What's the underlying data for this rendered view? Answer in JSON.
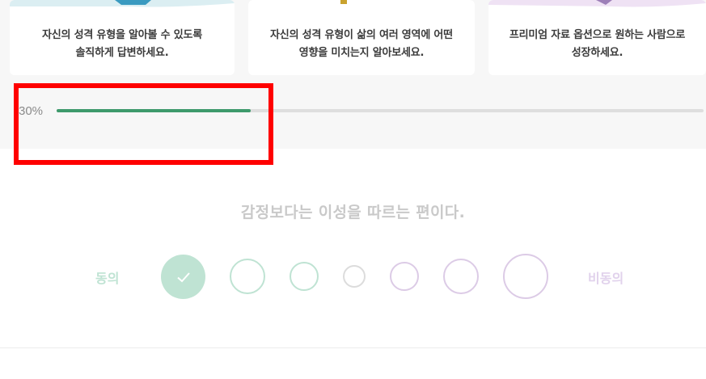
{
  "cards": [
    {
      "text": "자신의 성격 유형을 알아볼 수 있도록\n솔직하게 답변하세요."
    },
    {
      "text": "자신의 성격 유형이 삶의 여러 영역에 어떤\n영향을 미치는지 알아보세요."
    },
    {
      "text": "프리미엄 자료 옵션으로 원하는 사람으로\n성장하세요."
    }
  ],
  "progress": {
    "percent_label": "30%",
    "value": 0.3,
    "color": "#3e9a6c"
  },
  "question": {
    "text": "감정보다는 이성을 따르는 편이다."
  },
  "scale": {
    "agree_label": "동의",
    "disagree_label": "비동의",
    "selected_index": 0,
    "options": [
      {
        "state": "selected",
        "color": "#bfe3d3",
        "icon": "check-icon"
      },
      {
        "state": "unselected",
        "color": "#bfe3d3"
      },
      {
        "state": "unselected",
        "color": "#bfe3d3"
      },
      {
        "state": "unselected",
        "color": "#dcdcdc"
      },
      {
        "state": "unselected",
        "color": "#dccbe6"
      },
      {
        "state": "unselected",
        "color": "#dccbe6"
      },
      {
        "state": "unselected",
        "color": "#dccbe6"
      }
    ]
  },
  "colors": {
    "agree": "#bfe3d3",
    "disagree": "#dccbe6",
    "highlight": "#ff0000"
  }
}
